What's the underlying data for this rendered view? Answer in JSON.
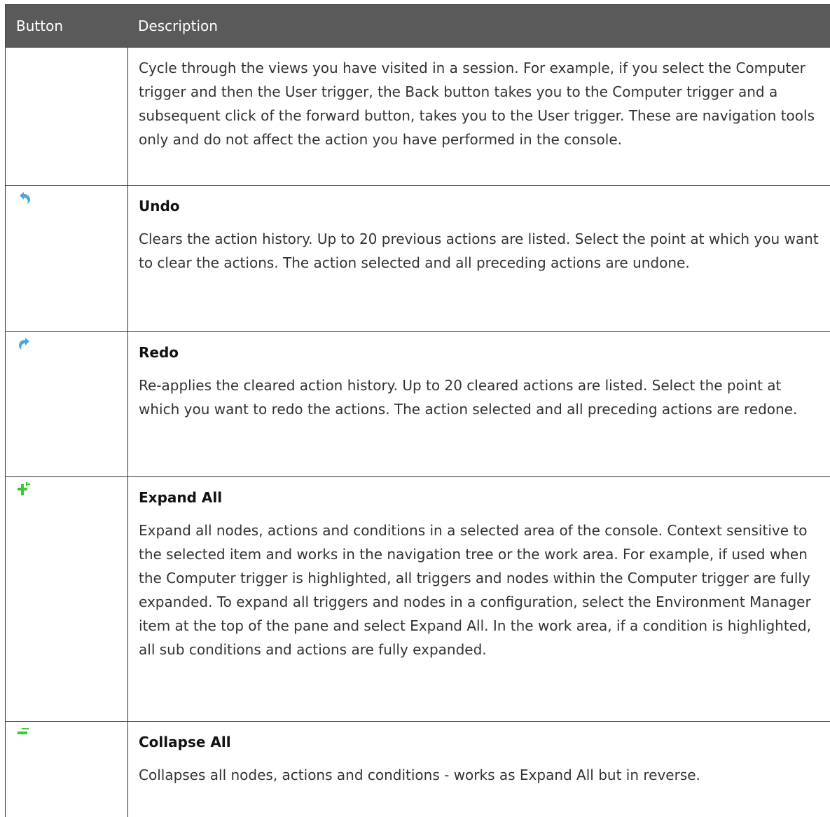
{
  "header": {
    "col_button": "Button",
    "col_description": "Description"
  },
  "rows": [
    {
      "icon": "",
      "title": "",
      "description": "Cycle through the views you have visited in a session. For example, if you select the Computer trigger and then the User trigger, the Back button takes you to the Computer trigger and a subsequent click of the forward button, takes you to the User trigger. These are navigation tools only and do not affect the action you have performed in the console."
    },
    {
      "icon": "undo-icon",
      "title": "Undo",
      "description": "Clears the action history. Up to 20 previous actions are listed. Select the point at which you want to clear the actions. The action selected and all preceding actions are undone."
    },
    {
      "icon": "redo-icon",
      "title": "Redo",
      "description": "Re-applies the cleared action history. Up to 20 cleared actions are listed. Select the point at which you want to redo the actions. The action selected and all preceding actions are redone."
    },
    {
      "icon": "expand-all-icon",
      "title": "Expand All",
      "description": "Expand all nodes, actions and conditions in a selected area of the console. Context sensitive to the selected item and works in the navigation tree or the work area. For example, if used when the Computer trigger is highlighted, all triggers and nodes within the Computer trigger are fully expanded. To expand all triggers and nodes in a configuration, select the Environment Manager item at the top of the pane and select Expand All. In the work area, if a condition is highlighted, all sub conditions and actions are fully expanded."
    },
    {
      "icon": "collapse-all-icon",
      "title": "Collapse All",
      "description": "Collapses all nodes, actions and conditions - works as Expand All but in reverse."
    }
  ],
  "colors": {
    "header_bg": "#5a5a5a",
    "undo_icon": "#4da6e0",
    "redo_icon": "#4da6e0",
    "expand_icon": "#33cc33",
    "collapse_icon": "#33cc33"
  }
}
